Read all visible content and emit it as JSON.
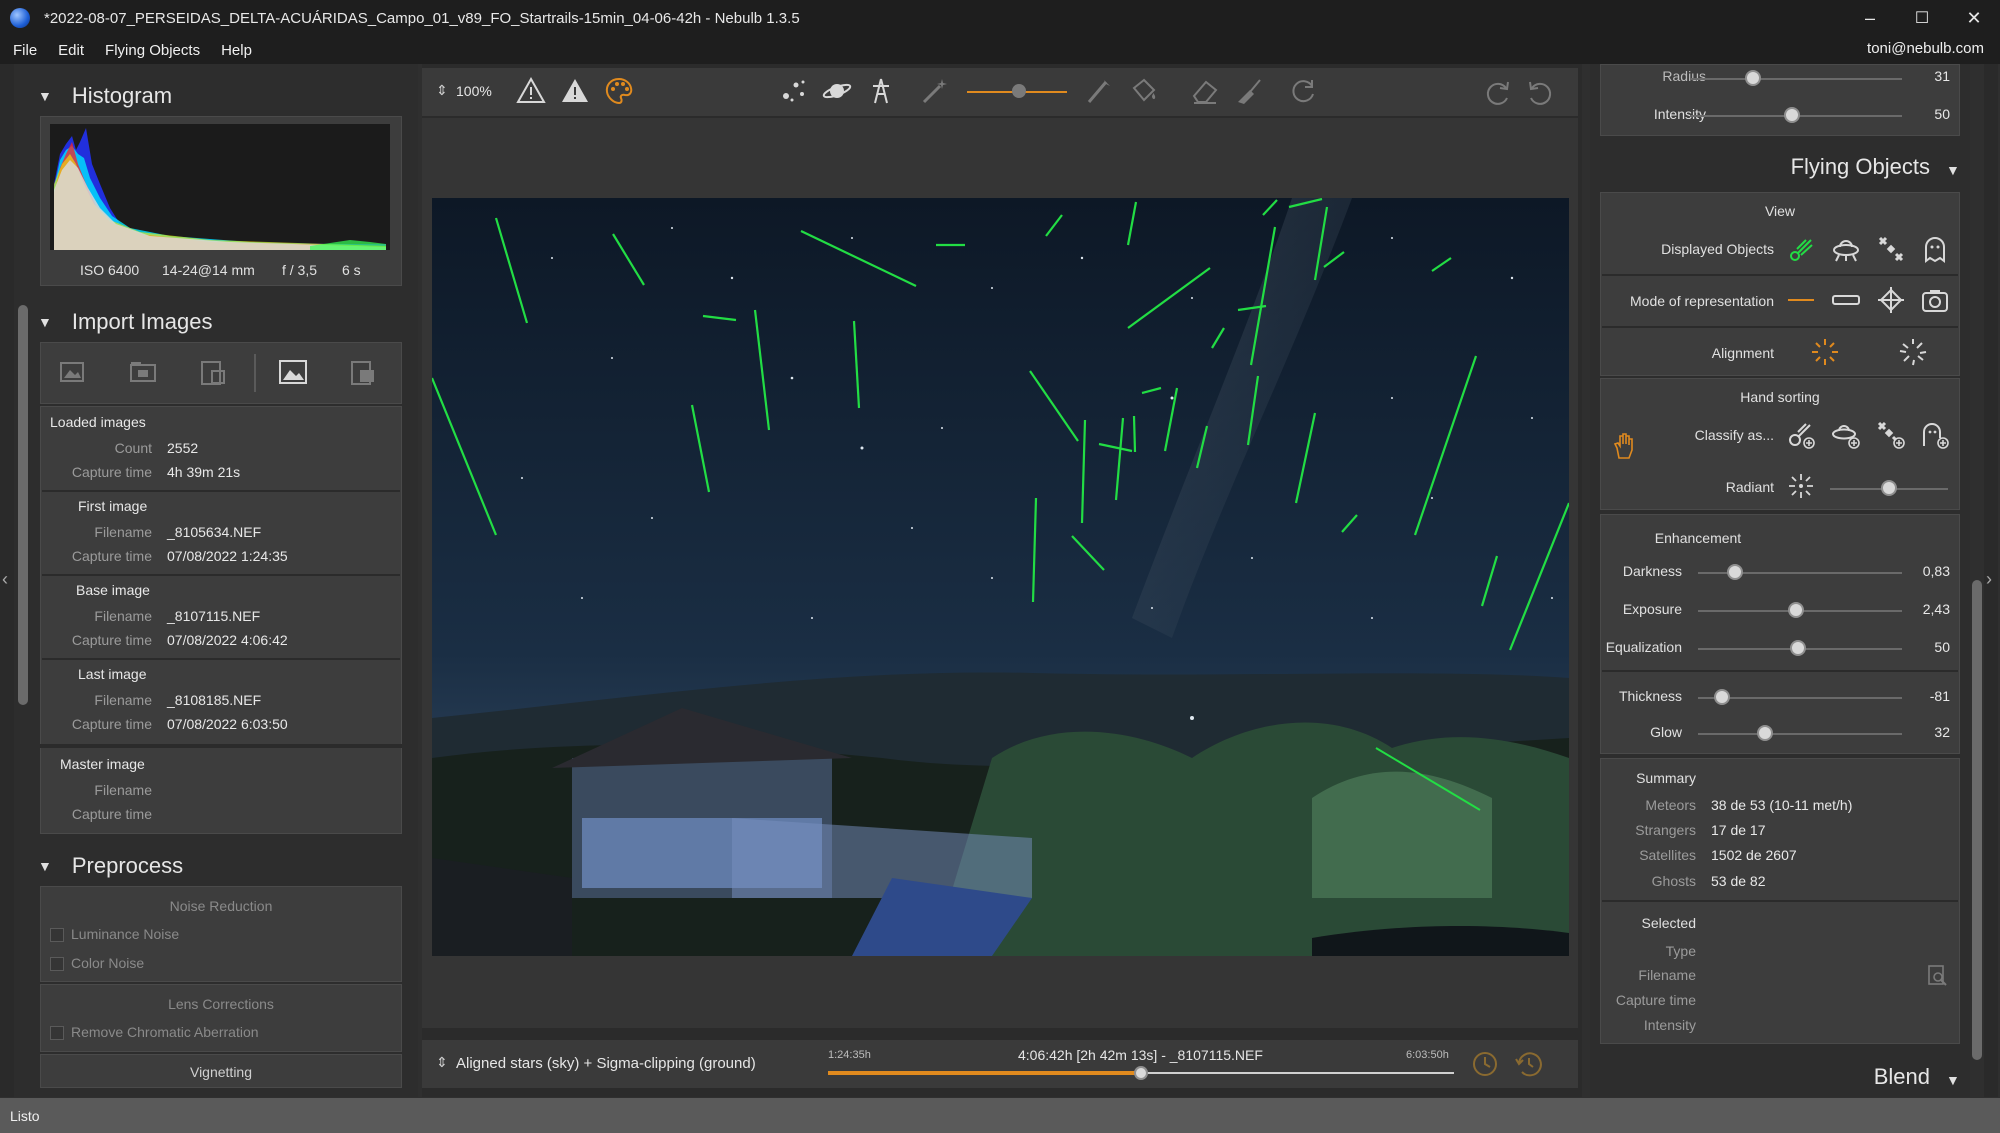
{
  "window": {
    "title": "*2022-08-07_PERSEIDAS_DELTA-ACUÁRIDAS_Campo_01_v89_FO_Startrails-15min_04-06-42h - Nebulb 1.3.5",
    "minimize": "–",
    "maximize": "☐",
    "close": "✕"
  },
  "menu": {
    "file": "File",
    "edit": "Edit",
    "flying_objects": "Flying Objects",
    "help": "Help",
    "user": "toni@nebulb.com"
  },
  "histogram": {
    "title": "Histogram",
    "iso": "ISO 6400",
    "lens": "14-24@14 mm",
    "aperture": "f / 3,5",
    "exposure": "6 s"
  },
  "import": {
    "title": "Import Images",
    "loaded": {
      "label": "Loaded images",
      "count_key": "Count",
      "count": "2552",
      "time_key": "Capture time",
      "time": "4h 39m 21s"
    },
    "first": {
      "label": "First image",
      "file_key": "Filename",
      "file": "_8105634.NEF",
      "time_key": "Capture time",
      "time": "07/08/2022 1:24:35"
    },
    "base": {
      "label": "Base image",
      "file_key": "Filename",
      "file": "_8107115.NEF",
      "time_key": "Capture time",
      "time": "07/08/2022 4:06:42"
    },
    "last": {
      "label": "Last image",
      "file_key": "Filename",
      "file": "_8108185.NEF",
      "time_key": "Capture time",
      "time": "07/08/2022 6:03:50"
    },
    "master": {
      "label": "Master image",
      "file_key": "Filename",
      "time_key": "Capture time"
    }
  },
  "preprocess": {
    "title": "Preprocess",
    "noise_reduction": "Noise Reduction",
    "luminance_noise": "Luminance Noise",
    "color_noise": "Color Noise",
    "lens_corrections": "Lens Corrections",
    "remove_ca": "Remove Chromatic Aberration",
    "vignetting": "Vignetting"
  },
  "toolbar": {
    "zoom": "100%",
    "zoom_arrows": "⇕"
  },
  "bottom": {
    "arrows": "⇕",
    "stack_mode": "Aligned stars (sky) + Sigma-clipping (ground)",
    "start": "1:24:35h",
    "current": "4:06:42h [2h 42m 13s] - _8107115.NEF",
    "end": "6:03:50h",
    "timeline_position": 0.5
  },
  "right": {
    "radius_label": "Radius",
    "radius_value": "31",
    "intensity_label": "Intensity",
    "intensity_value": "50",
    "flying_objects_title": "Flying Objects",
    "view_title": "View",
    "displayed_objects": "Displayed Objects",
    "mode_of_representation": "Mode of representation",
    "alignment": "Alignment",
    "hand_sorting": "Hand sorting",
    "classify_as": "Classify as...",
    "radiant": "Radiant",
    "enhancement": "Enhancement",
    "darkness_label": "Darkness",
    "darkness_value": "0,83",
    "exposure_label": "Exposure",
    "exposure_value": "2,43",
    "equalization_label": "Equalization",
    "equalization_value": "50",
    "thickness_label": "Thickness",
    "thickness_value": "-81",
    "glow_label": "Glow",
    "glow_value": "32",
    "summary": {
      "title": "Summary",
      "meteors_key": "Meteors",
      "meteors": "38 de 53 (10-11 met/h)",
      "strangers_key": "Strangers",
      "strangers": "17 de 17",
      "satellites_key": "Satellites",
      "satellites": "1502 de 2607",
      "ghosts_key": "Ghosts",
      "ghosts": "53 de 82"
    },
    "selected": {
      "title": "Selected",
      "type_key": "Type",
      "filename_key": "Filename",
      "time_key": "Capture time",
      "intensity_key": "Intensity"
    },
    "blend_title": "Blend"
  },
  "status": {
    "text": "Listo"
  },
  "colors": {
    "accent": "#e08a1e",
    "meteor": "#22dd44",
    "panel": "#3d3d3d"
  }
}
